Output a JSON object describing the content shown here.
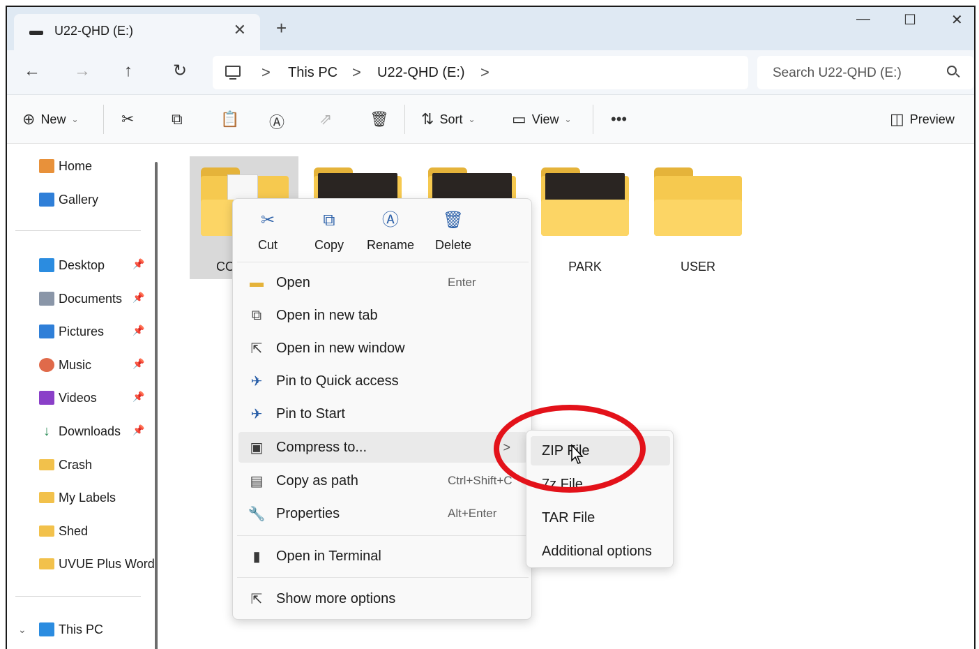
{
  "window": {
    "tab_title": "U22-QHD (E:)",
    "tab_close": "✕",
    "new_tab": "+",
    "minimize": "—",
    "maximize": "☐",
    "close": "✕"
  },
  "nav": {
    "back": "←",
    "forward": "→",
    "up": "↑",
    "refresh": "↻",
    "breadcrumb": [
      "This PC",
      "U22-QHD (E:)"
    ],
    "separator": ">",
    "search_placeholder": "Search U22-QHD (E:)"
  },
  "toolbar": {
    "new_label": "New",
    "sort_label": "Sort",
    "view_label": "View",
    "more": "•••",
    "preview_label": "Preview"
  },
  "sidebar": {
    "items": [
      {
        "label": "Home",
        "icon": "home-icon",
        "color": "#e8913a"
      },
      {
        "label": "Gallery",
        "icon": "gallery-icon",
        "color": "#2f7fd8"
      },
      {
        "label": "Desktop",
        "icon": "desktop-icon",
        "color": "#2b8ce0",
        "pinned": true
      },
      {
        "label": "Documents",
        "icon": "documents-icon",
        "color": "#8a96a8",
        "pinned": true
      },
      {
        "label": "Pictures",
        "icon": "pictures-icon",
        "color": "#2f7fd8",
        "pinned": true
      },
      {
        "label": "Music",
        "icon": "music-icon",
        "color": "#e06a4a",
        "pinned": true
      },
      {
        "label": "Videos",
        "icon": "videos-icon",
        "color": "#8a3fc8",
        "pinned": true
      },
      {
        "label": "Downloads",
        "icon": "downloads-icon",
        "color": "#2f8f5a",
        "pinned": true
      },
      {
        "label": "Crash",
        "icon": "folder-icon",
        "color": "#f2c14b"
      },
      {
        "label": "My Labels",
        "icon": "folder-icon",
        "color": "#f2c14b"
      },
      {
        "label": "Shed",
        "icon": "folder-icon",
        "color": "#f2c14b"
      },
      {
        "label": "UVUE Plus Word",
        "icon": "folder-icon",
        "color": "#f2c14b"
      },
      {
        "label": "This PC",
        "icon": "this-pc-icon",
        "color": "#2b8ce0"
      }
    ],
    "pin_glyph": "📌"
  },
  "content": {
    "folders": [
      {
        "name": "CO",
        "has_doc": true,
        "has_photo": false
      },
      {
        "name": "",
        "has_doc": false,
        "has_photo": true
      },
      {
        "name": "",
        "has_doc": false,
        "has_photo": true
      },
      {
        "name": "PARK",
        "has_doc": false,
        "has_photo": true
      },
      {
        "name": "USER",
        "has_doc": false,
        "has_photo": false
      }
    ]
  },
  "context_menu": {
    "quick_actions": [
      {
        "label": "Cut",
        "icon": "scissors-icon"
      },
      {
        "label": "Copy",
        "icon": "copy-icon"
      },
      {
        "label": "Rename",
        "icon": "rename-icon"
      },
      {
        "label": "Delete",
        "icon": "trash-icon"
      }
    ],
    "items": [
      {
        "label": "Open",
        "shortcut": "Enter",
        "icon": "folder-open-icon"
      },
      {
        "label": "Open in new tab",
        "shortcut": "",
        "icon": "new-tab-icon"
      },
      {
        "label": "Open in new window",
        "shortcut": "",
        "icon": "new-window-icon"
      },
      {
        "label": "Pin to Quick access",
        "shortcut": "",
        "icon": "pin-icon"
      },
      {
        "label": "Pin to Start",
        "shortcut": "",
        "icon": "pin-icon"
      },
      {
        "label": "Compress to...",
        "shortcut": "",
        "icon": "archive-icon",
        "has_submenu": true
      },
      {
        "label": "Copy as path",
        "shortcut": "Ctrl+Shift+C",
        "icon": "path-icon"
      },
      {
        "label": "Properties",
        "shortcut": "Alt+Enter",
        "icon": "wrench-icon"
      },
      {
        "label": "Open in Terminal",
        "shortcut": "",
        "icon": "terminal-icon"
      },
      {
        "label": "Show more options",
        "shortcut": "",
        "icon": "more-options-icon"
      }
    ],
    "submenu_arrow": ">"
  },
  "submenu": {
    "items": [
      "ZIP File",
      "7z File",
      "TAR File",
      "Additional options"
    ]
  },
  "colors": {
    "highlight_ring": "#e3121a",
    "accent": "#2a5fa8"
  }
}
